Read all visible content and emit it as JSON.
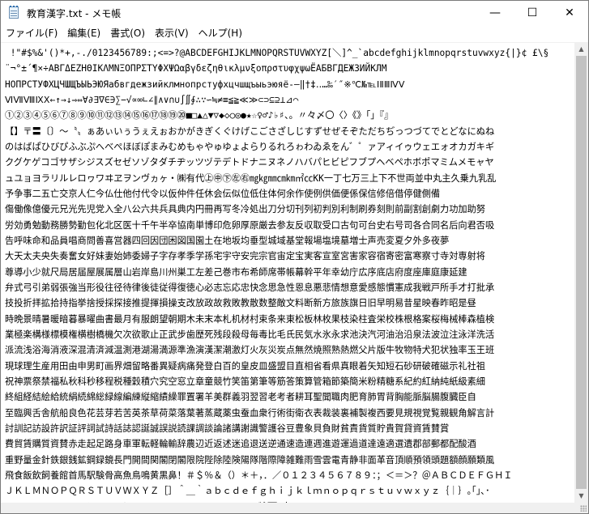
{
  "window": {
    "title": "教育漢字.txt - メモ帳",
    "minimize_glyph": "—",
    "maximize_glyph": "☐",
    "close_glyph": "✕",
    "icon": "notepad-icon"
  },
  "menu": {
    "items": [
      {
        "label": "ファイル(F)"
      },
      {
        "label": "編集(E)"
      },
      {
        "label": "書式(O)"
      },
      {
        "label": "表示(V)"
      },
      {
        "label": "ヘルプ(H)"
      }
    ]
  },
  "editor": {
    "lines": [
      " !\"#$%&'()*+,-./0123456789:;<=>?@ABCDEFGHIJKLMNOPQRSTUVWXYZ[＼]^_`abcdefghijklmnopqrstuvwxyz{|}¢ £\\§",
      "¨¬°±´¶×÷ΑΒΓΔΕΖΗΘΙΚΛΜΝΞΟΠΡΣΤΥΦΧΨΩαβγδεζηθικλμνξοπρστυφχψωЁАБВГДЕЖЗИЙКЛМ",
      "НОПРСТУФХЦЧШЩЪЫЬЭЮЯабвгдежзийклмнопрстуфхцчшщъыьэюяё‐―‖†‡‥…‰′″※℃№℡ⅠⅡⅢⅣⅤ",
      "ⅥⅦⅧⅨⅩ←↑→↓⇒⇔∀∂∃∇∈∋∑−√∝∞∟∠∥∧∨∩∪∫∬∮∴∵∽≒≠≡≦≧≪≫⊂⊃⊆⊇⊥⊿⌒",
      "①②③④⑤⑥⑦⑧⑨⑩⑪⑫⑬⑭⑮⑯⑰⑱⑲⑳■□▲△▼▽◆◇○◎●★☆♀♂♪♭♯、。〃々〆〇〈〉《》「」『』",
      "【】〒〓〔〕〜〝〟ぁあぃいぅうぇえぉおかがきぎくぐけげこごさざしじすずせぜそぞただちぢっつづてでとどなにぬね",
      "のはばぱひびぴふぶぷへべぺほぼぽまみむめもゃやゅゆょよらりるれろゎわゐゑをん゛゜ァアィイゥウェエォオカガキギ",
      "クグケゲコゴサザシジスズセゼソゾタダチヂッツヅテデトドナニヌネノハバパヒビピフブプヘベペホボポマミムメモャヤ",
      "ュユョヨラリルレロヮワヰヱヲンヴヵヶ・㈱有代㊤㊥㊦㊧㊨㎎㎏㎜㎝㎞㎡㏄KK一丁七万三上下不世両並中丸主久乗九乳乱",
      "予争事二五亡交京人仁今仏仕他付代令以仮仲件任休会伝似位低住体何余作使例供価便係保信修倍借停健側備",
      "傷働像億優元兄光先児党入全八公六共兵具典内円冊再写冬冷処出刀分切刊列初判別利制刷券刻則前副割創劇力功加助努",
      "労効勇勉動務勝勢勤包化北区医十千午半卒協南単博印危卵厚原厳去参友反収取受口古句可台史右号司各合同名后向君否吸",
      "告呼味命和品員唱商問善喜営器四回因団困図国園土在地坂均垂型城域基堂報場塩境墓増士声売変夏夕外多夜夢",
      "大天太夫央失奏奮女好妹妻始姉委婦子字存孝季学孫宅宇守安完宗官宙定宝実客宣室宮害家容宿寄密富寒察寸寺対専射将",
      "尊導小少就尺局居届屋展属層山岩岸島川州巣工左差己巻市布希師席帯帳幕幹平年幸幼庁広序底店府度座庫庭康延建",
      "弁式弓引弟弱張強当形役往径待律後徒従得復徳心必志忘応忠快念思急性恩息悪悲情想意愛感態慣憲成我戦戸所手才打批承",
      "技投折拝拡拾持指挙捨授採探接推提揮損操支改放政故救敗教散数整敵文料断新方旅族旗日旧早明易昔星映春昨昭是昼",
      "時晩景晴暑暖暗暮暴曜曲書最月有服朗望朝期木未末本札机材村束条来東松板林枚果枝染柱査栄校株根格案桜梅械棒森植検",
      "業極楽構様標模権横樹橋機欠次欲歌止正武步歯歴死残段殺母毎毒比毛氏民気水氷永求池決汽河油治沿泉法波泣注泳洋洗活",
      "派流浅浴海消液深混清済減温測港湖湯満源準漁演漢潔潮激灯火灰災炭点無然焼照熟熱燃父片版牛牧物特犬犯状独率玉王班",
      "現球理生産用田由申男町画界畑留略番異疑病痛発登白百的皇皮皿盛盟目直相省看県真眼着矢知短石砂研破確磁示礼社祖",
      "祝神票祭禁福私秋科秒移程税種穀積穴究空窓立章童競竹笑笛第筆等筋答策算管箱節築簡米粉精糖系紀約紅納純紙級素細",
      "終組経結絵給統絹続綿総緑線編練縦縮績繰罪置署羊美群義羽翌習老考者耕耳聖聞職肉肥育肺胃背胸能脈脳腸腹臓臣自",
      "至臨興舌舎航船良色花芸芽若苦英茶草荷菜落葉著蒸蔵薬虫蚕血衆行術街衛衣表裁装裏補製複西要見規視覚覧親観角解言計",
      "討訓記訪設許訳証評詞試詩話誌認誕誠誤説読課調談論諸講謝識警護谷豆豊象貝負財貧責貨質貯貴賀貸資賃賛賞",
      "費貿賃購質資賛赤走起足路身車軍転軽輪輸辞農辺近返述迷追退送逆通速造連週進遊運過道達遠適選遺郡部郵都配酸酒",
      "重野量金針鉄銀銭鉱鋼録鏡長門開間関閣閉閣限院陛除陸険陽隊階際障雑難雨雪雲電青静非面革音頂順預領頭題額顔願類風",
      "飛食飯飲飼養館首馬駅験骨高魚鳥鳴黄黒鼻！＃＄％＆（）＊＋，．／０１２３４５６７８９：；＜＝＞？＠ＡＢＣＤＥＦＧＨＩ",
      "ＪＫＬＭＮＯＰＱＲＳＴＵＶＷＸＹＺ［］＾＿｀ａｂｃｄｅｆｇｈｉｊｋｌｍｎｏｐｑｒｓｔｕｖｗｘｙｚ｛｜｝｡｢｣､･",
      "ｦｧｨｩｪｫｬｭｮｯｰｱｲｳｴｵｶｷｸｹｺｻｼｽｾｿﾀﾁﾂﾃﾄﾅﾆﾇﾈﾉﾊﾋﾌﾍﾎﾏﾐﾑﾒﾓﾔﾕﾖﾗﾘﾙﾚﾛﾜﾝﾞﾟ￣￥"
    ]
  }
}
